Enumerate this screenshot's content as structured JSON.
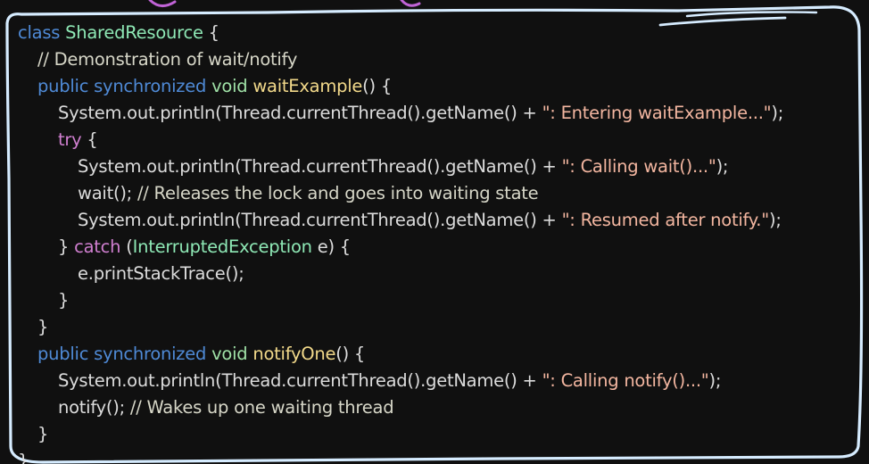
{
  "code": {
    "language": "java",
    "lines": [
      {
        "indent": 0,
        "tokens": [
          {
            "t": "class ",
            "k": "keyword"
          },
          {
            "t": "SharedResource",
            "k": "class"
          },
          {
            "t": " {",
            "k": "plain"
          }
        ]
      },
      {
        "indent": 1,
        "tokens": [
          {
            "t": "// Demonstration of wait/notify",
            "k": "comment"
          }
        ]
      },
      {
        "indent": 1,
        "tokens": [
          {
            "t": "public synchronized ",
            "k": "keyword"
          },
          {
            "t": "void ",
            "k": "type"
          },
          {
            "t": "waitExample",
            "k": "method"
          },
          {
            "t": "() {",
            "k": "plain"
          }
        ]
      },
      {
        "indent": 2,
        "tokens": [
          {
            "t": "System.out.println(Thread.currentThread().getName() + ",
            "k": "plain"
          },
          {
            "t": "\": Entering waitExample...\"",
            "k": "string"
          },
          {
            "t": ");",
            "k": "plain"
          }
        ]
      },
      {
        "indent": 2,
        "tokens": [
          {
            "t": "try",
            "k": "ctrl"
          },
          {
            "t": " {",
            "k": "plain"
          }
        ]
      },
      {
        "indent": 3,
        "tokens": [
          {
            "t": "System.out.println(Thread.currentThread().getName() + ",
            "k": "plain"
          },
          {
            "t": "\": Calling wait()...\"",
            "k": "string"
          },
          {
            "t": ");",
            "k": "plain"
          }
        ]
      },
      {
        "indent": 3,
        "tokens": [
          {
            "t": "wait(); ",
            "k": "plain"
          },
          {
            "t": "// Releases the lock and goes into waiting state",
            "k": "comment"
          }
        ]
      },
      {
        "indent": 3,
        "tokens": [
          {
            "t": "System.out.println(Thread.currentThread().getName() + ",
            "k": "plain"
          },
          {
            "t": "\": Resumed after notify.\"",
            "k": "string"
          },
          {
            "t": ");",
            "k": "plain"
          }
        ]
      },
      {
        "indent": 2,
        "tokens": [
          {
            "t": "} ",
            "k": "plain"
          },
          {
            "t": "catch",
            "k": "ctrl"
          },
          {
            "t": " (",
            "k": "plain"
          },
          {
            "t": "InterruptedException",
            "k": "class"
          },
          {
            "t": " e) {",
            "k": "plain"
          }
        ]
      },
      {
        "indent": 3,
        "tokens": [
          {
            "t": "e.printStackTrace();",
            "k": "plain"
          }
        ]
      },
      {
        "indent": 2,
        "tokens": [
          {
            "t": "}",
            "k": "plain"
          }
        ]
      },
      {
        "indent": 1,
        "tokens": [
          {
            "t": "}",
            "k": "plain"
          }
        ]
      },
      {
        "indent": 1,
        "tokens": [
          {
            "t": "public synchronized ",
            "k": "keyword"
          },
          {
            "t": "void ",
            "k": "type"
          },
          {
            "t": "notifyOne",
            "k": "method"
          },
          {
            "t": "() {",
            "k": "plain"
          }
        ]
      },
      {
        "indent": 2,
        "tokens": [
          {
            "t": "System.out.println(Thread.currentThread().getName() + ",
            "k": "plain"
          },
          {
            "t": "\": Calling notify()...\"",
            "k": "string"
          },
          {
            "t": ");",
            "k": "plain"
          }
        ]
      },
      {
        "indent": 2,
        "tokens": [
          {
            "t": "notify(); ",
            "k": "plain"
          },
          {
            "t": "// Wakes up one waiting thread",
            "k": "comment"
          }
        ]
      },
      {
        "indent": 1,
        "tokens": [
          {
            "t": "}",
            "k": "plain"
          }
        ]
      },
      {
        "indent": 0,
        "tokens": [
          {
            "t": "}",
            "k": "plain"
          }
        ]
      }
    ]
  },
  "colors": {
    "background": "#101010",
    "frame_stroke": "#d6ecff",
    "keyword": "#4f8ad6",
    "class_name": "#8ee8b5",
    "method_name": "#f2d98a",
    "string": "#f3b6a0",
    "comment": "#d7d7c8",
    "control_keyword": "#d07fd0",
    "plain": "#dcdcdc"
  }
}
